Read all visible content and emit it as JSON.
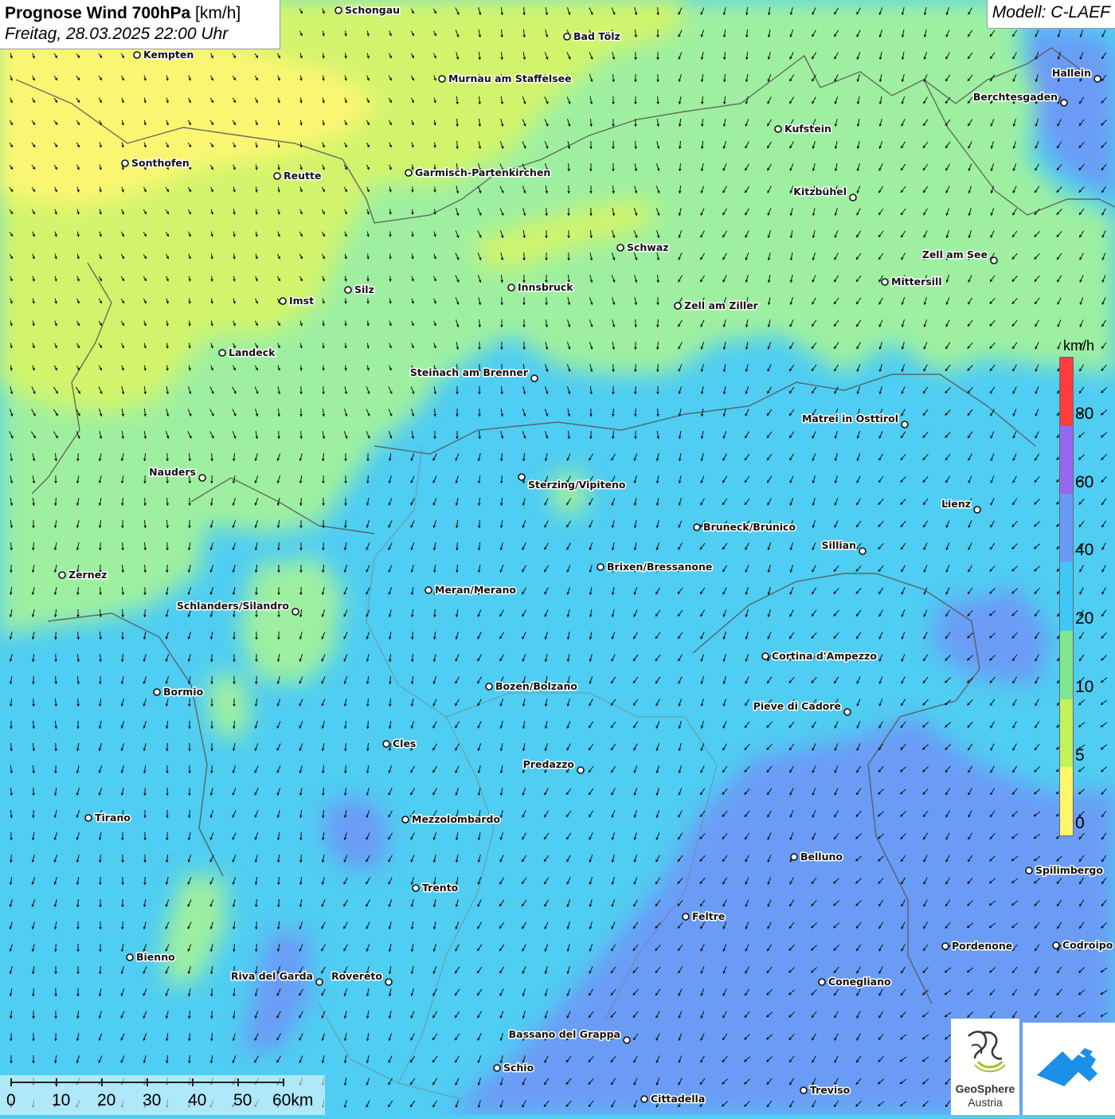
{
  "title": {
    "main": "Prognose Wind 700hPa",
    "unit": "[km/h]",
    "datetime": "Freitag, 28.03.2025 22:00 Uhr"
  },
  "model": "Modell: C-LAEF",
  "legend": {
    "unit": "km/h",
    "labels": [
      "80",
      "60",
      "40",
      "20",
      "10",
      "5",
      "0"
    ],
    "colors": [
      "#ff3b3b",
      "#9966f0",
      "#6a9af6",
      "#3fc8f5",
      "#7fe88f",
      "#c4f05a",
      "#fff56a"
    ]
  },
  "scale_bar": {
    "labels": [
      "0",
      "10",
      "20",
      "30",
      "40",
      "50",
      "60km"
    ]
  },
  "cities": [
    {
      "name": "Schongau",
      "side": "right"
    },
    {
      "name": "Bad Tölz",
      "side": "right"
    },
    {
      "name": "Kempten",
      "side": "right"
    },
    {
      "name": "Murnau am Staffelsee",
      "side": "right"
    },
    {
      "name": "Hallein",
      "side": "left"
    },
    {
      "name": "Berchtesgaden",
      "side": "left"
    },
    {
      "name": "Kufstein",
      "side": "right"
    },
    {
      "name": "Sonthofen",
      "side": "right"
    },
    {
      "name": "Reutte",
      "side": "right"
    },
    {
      "name": "Garmisch-Partenkirchen",
      "side": "right"
    },
    {
      "name": "Kitzbühel",
      "side": "left"
    },
    {
      "name": "Schwaz",
      "side": "right"
    },
    {
      "name": "Zell am See",
      "side": "left"
    },
    {
      "name": "Mittersill",
      "side": "right"
    },
    {
      "name": "Innsbruck",
      "side": "right"
    },
    {
      "name": "Silz",
      "side": "right"
    },
    {
      "name": "Imst",
      "side": "right"
    },
    {
      "name": "Zell am Ziller",
      "side": "right"
    },
    {
      "name": "Landeck",
      "side": "right"
    },
    {
      "name": "Steinach am Brenner",
      "side": "left"
    },
    {
      "name": "Matrei in Osttirol",
      "side": "left"
    },
    {
      "name": "Nauders",
      "side": "left"
    },
    {
      "name": "Sterzing/Vipiteno",
      "side": "below"
    },
    {
      "name": "Lienz",
      "side": "left"
    },
    {
      "name": "Bruneck/Brunico",
      "side": "right"
    },
    {
      "name": "Sillian",
      "side": "left"
    },
    {
      "name": "Brixen/Bressanone",
      "side": "right"
    },
    {
      "name": "Zernez",
      "side": "right"
    },
    {
      "name": "Meran/Merano",
      "side": "right"
    },
    {
      "name": "Schlanders/Silandro",
      "side": "left"
    },
    {
      "name": "Cortina d'Ampezzo",
      "side": "right"
    },
    {
      "name": "Bozen/Bolzano",
      "side": "right"
    },
    {
      "name": "Bormio",
      "side": "right"
    },
    {
      "name": "Pieve di Cadore",
      "side": "left"
    },
    {
      "name": "Cles",
      "side": "right"
    },
    {
      "name": "Predazzo",
      "side": "left"
    },
    {
      "name": "Tirano",
      "side": "right"
    },
    {
      "name": "Mezzolombardo",
      "side": "right"
    },
    {
      "name": "Belluno",
      "side": "right"
    },
    {
      "name": "Spilimbergo",
      "side": "right"
    },
    {
      "name": "Trento",
      "side": "right"
    },
    {
      "name": "Feltre",
      "side": "right"
    },
    {
      "name": "Pordenone",
      "side": "right"
    },
    {
      "name": "Codroipo",
      "side": "right"
    },
    {
      "name": "Bienno",
      "side": "right"
    },
    {
      "name": "Riva del Garda",
      "side": "left"
    },
    {
      "name": "Rovereto",
      "side": "left"
    },
    {
      "name": "Conegliano",
      "side": "right"
    },
    {
      "name": "Bassano del Grappa",
      "side": "left"
    },
    {
      "name": "Schio",
      "side": "right"
    },
    {
      "name": "Treviso",
      "side": "right"
    },
    {
      "name": "Cittadella",
      "side": "right"
    }
  ],
  "logo": {
    "name_line1": "GeoSphere",
    "name_line2": "Austria"
  }
}
